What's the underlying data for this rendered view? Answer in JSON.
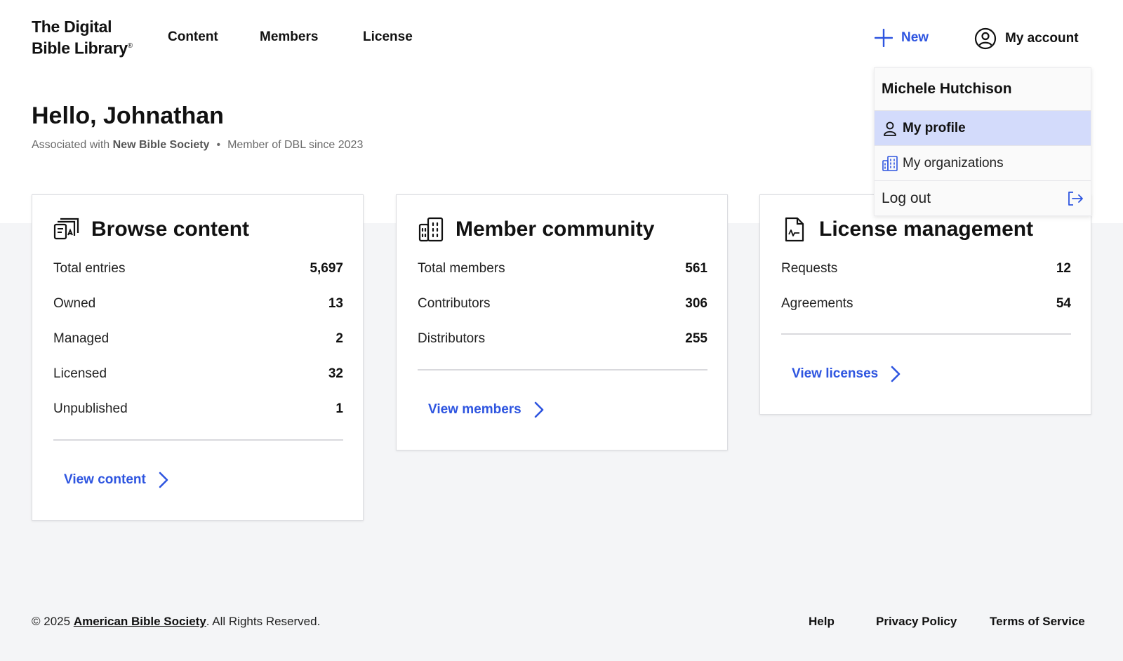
{
  "header": {
    "logo_line1": "The Digital",
    "logo_line2": "Bible Library",
    "logo_mark": "®",
    "nav": [
      {
        "label": "Content"
      },
      {
        "label": "Members"
      },
      {
        "label": "License"
      }
    ],
    "new_label": "New",
    "account_label": "My account",
    "accent_color": "#2e55e0"
  },
  "greeting": {
    "title": "Hello, Johnathan",
    "assoc_prefix": "Associated with",
    "organization": "New Bible Society",
    "separator": "•",
    "member_since": "Member of DBL since 2023"
  },
  "cards": [
    {
      "title": "Browse content",
      "icon": "browse-content-icon",
      "rows": [
        {
          "label": "Total entries",
          "value": "5,697"
        },
        {
          "label": "Owned",
          "value": "13"
        },
        {
          "label": "Managed",
          "value": "2"
        },
        {
          "label": "Licensed",
          "value": "32"
        },
        {
          "label": "Unpublished",
          "value": "1"
        }
      ],
      "link": "View content"
    },
    {
      "title": "Member community",
      "icon": "building-icon",
      "rows": [
        {
          "label": "Total members",
          "value": "561"
        },
        {
          "label": "Contributors",
          "value": "306"
        },
        {
          "label": "Distributors",
          "value": "255"
        }
      ],
      "link": "View members"
    },
    {
      "title": "License management",
      "icon": "license-document-icon",
      "rows": [
        {
          "label": "Requests",
          "value": "12"
        },
        {
          "label": "Agreements",
          "value": "54"
        }
      ],
      "link": "View licenses"
    }
  ],
  "account_menu": {
    "name": "Michele Hutchison",
    "items": [
      {
        "label": "My profile",
        "icon": "person-icon",
        "active": true
      },
      {
        "label": "My organizations",
        "icon": "building-icon",
        "active": false
      },
      {
        "label": "Log out",
        "icon": "logout-icon",
        "active": false
      }
    ],
    "active_bg": "#d3dbfb"
  },
  "footer": {
    "copyright_prefix": "© 2025",
    "org_link": "American Bible Society",
    "copyright_suffix": ". All Rights Reserved.",
    "links": [
      {
        "label": "Help"
      },
      {
        "label": "Privacy Policy"
      },
      {
        "label": "Terms of Service"
      }
    ]
  }
}
